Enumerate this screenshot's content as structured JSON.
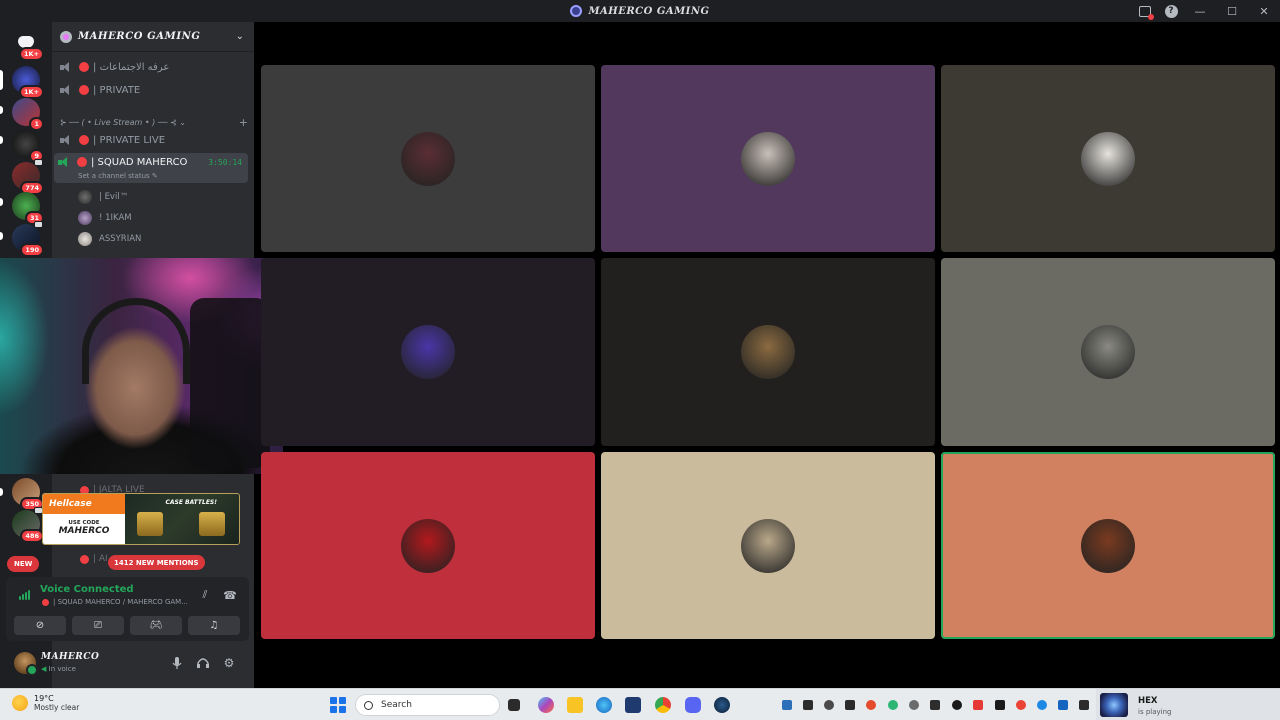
{
  "window": {
    "title": "MAHERCO GAMING"
  },
  "rail": {
    "badges": [
      "1K+",
      "1K+",
      "1",
      "9",
      "774",
      "31",
      "190",
      "350",
      "486"
    ],
    "new_label": "NEW"
  },
  "server": {
    "name": "MAHERCO GAMING"
  },
  "channels": [
    {
      "label": "| عرفه الاجتماعات"
    },
    {
      "label": "| PRIVATE"
    },
    {
      "label": "| PRIVATE LIVE"
    },
    {
      "label": "| SQUAD MAHERCO",
      "timer": "3:50:14",
      "status": "Set a channel status"
    }
  ],
  "category": {
    "label": "⊱ ── ( • Live Stream • ) ── ⊰ ⌄"
  },
  "members": [
    {
      "name": "| Evil™"
    },
    {
      "name": "! 1IKAM"
    },
    {
      "name": "ASSYRIAN"
    }
  ],
  "lower_channels": [
    {
      "label": "| JALTA LIVE"
    },
    {
      "label": "| AI"
    }
  ],
  "promo": {
    "brand": "Hellcase",
    "use_code_label": "USE CODE",
    "code": "MAHERCO",
    "headline": "CASE BATTLES!"
  },
  "mentions_pill": "1412 NEW MENTIONS",
  "voice": {
    "status": "Voice Connected",
    "channel": "| SQUAD MAHERCO / MAHERCO GAM..."
  },
  "user": {
    "name": "MAHERCO",
    "status": "In voice"
  },
  "tiles": [
    {
      "bg": "#3c3c3c",
      "pfp": "#5a2e33"
    },
    {
      "bg": "#53385d",
      "pfp": "#c9c0b8"
    },
    {
      "bg": "#3c3a32",
      "pfp": "#e6e3dd"
    },
    {
      "bg": "#221c24",
      "pfp": "#4a36a8"
    },
    {
      "bg": "#221f1f",
      "pfp": "#8a6a40"
    },
    {
      "bg": "#6b6b64",
      "pfp": "#8a8a82"
    },
    {
      "bg": "#c02f3c",
      "pfp": "#b3191d"
    },
    {
      "bg": "#cbbb9d",
      "pfp": "#b9a88a"
    },
    {
      "bg": "#d18160",
      "pfp": "#7a3b20",
      "speaking": true
    }
  ],
  "taskbar": {
    "temperature": "19°C",
    "condition": "Mostly clear",
    "search_placeholder": "Search",
    "now_playing_game": "HEX",
    "now_playing_status": "is playing"
  },
  "colors": {
    "accent_green": "#23a55a",
    "danger_red": "#f23f43",
    "sidebar": "#2b2d31",
    "rail": "#1e1f22"
  }
}
